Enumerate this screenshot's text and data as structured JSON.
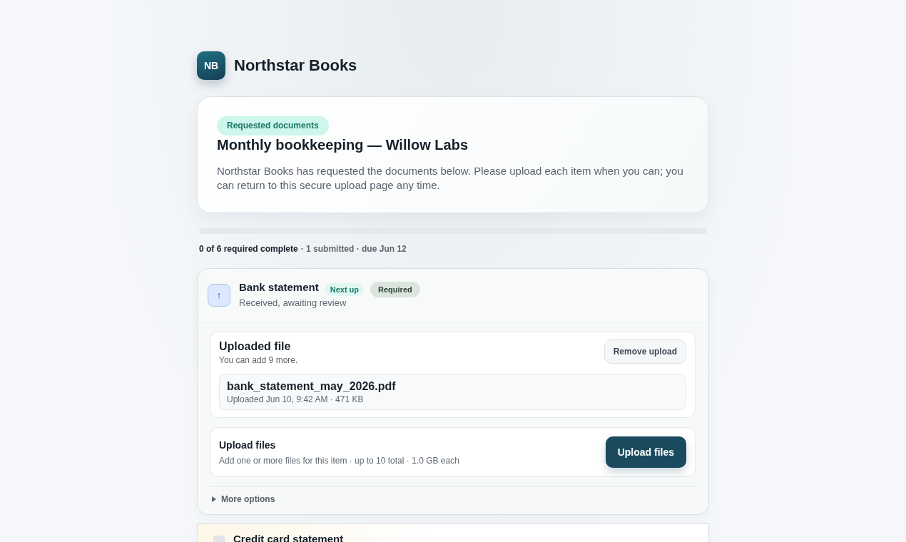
{
  "brand": {
    "logo": "NB",
    "name": "Northstar Books"
  },
  "request": {
    "tag": "Requested documents",
    "title": "Monthly bookkeeping — Willow Labs",
    "description": "Northstar Books has requested the documents below. Please upload each item when you can; you can return to this secure upload page any time."
  },
  "progress": {
    "level": 0,
    "summary": "0 of 6 required complete",
    "details": "· 1 submitted · due Jun 12"
  },
  "items": [
    {
      "title": "Bank statement",
      "icon": "↑",
      "status": "Received, awaiting review",
      "badges": [
        {
          "label": "Next up",
          "kind": "next"
        },
        {
          "label": "Required",
          "kind": "required"
        }
      ],
      "uploaded": {
        "title": "Uploaded file",
        "note": "You can add 9 more.",
        "action": "Remove upload",
        "files": [
          {
            "name": "bank_statement_may_2026.pdf",
            "meta": "Uploaded Jun 10, 9:42 AM · 471 KB"
          }
        ]
      },
      "upload": {
        "title": "Upload files",
        "hint": "Add one or more files for this item · up to 10 total · 1.0 GB each",
        "button": "Upload files"
      },
      "more_options": "More options"
    },
    {
      "title": "Credit card statement"
    }
  ]
}
